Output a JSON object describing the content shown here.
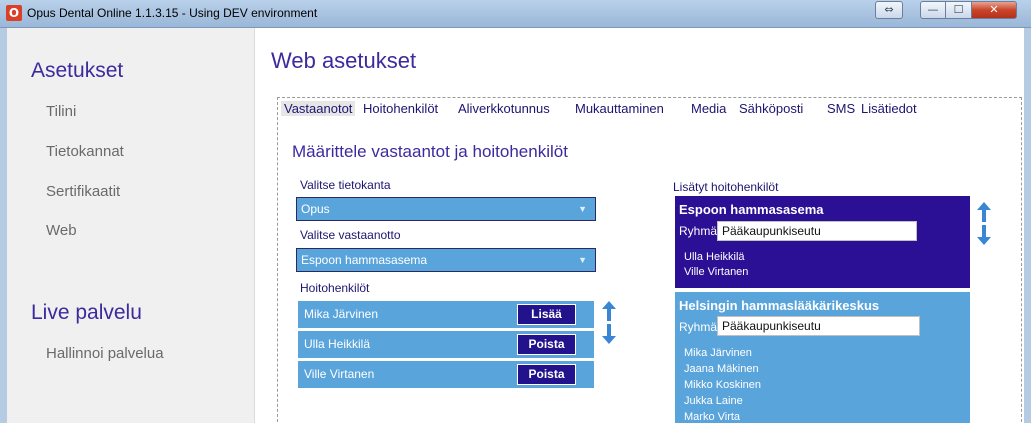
{
  "window": {
    "title": "Opus Dental Online 1.1.3.15 - Using DEV environment",
    "close_glyph": "✕",
    "minimize_glyph": "—",
    "maximize_glyph": "☐",
    "resize_glyph": "⇔"
  },
  "sidebar": {
    "header_settings": "Asetukset",
    "items": [
      {
        "label": "Tilini"
      },
      {
        "label": "Tietokannat"
      },
      {
        "label": "Sertifikaatit"
      },
      {
        "label": "Web"
      }
    ],
    "header_live": "Live palvelu",
    "live_items": [
      {
        "label": "Hallinnoi palvelua"
      }
    ]
  },
  "main": {
    "title": "Web asetukset",
    "tabs": [
      {
        "label": "Vastaanotot",
        "active": true
      },
      {
        "label": "Hoitohenkilöt"
      },
      {
        "label": "Aliverkkotunnus"
      },
      {
        "label": "Mukauttaminen"
      },
      {
        "label": "Media"
      },
      {
        "label": "Sähköposti"
      },
      {
        "label": "SMS"
      },
      {
        "label": "Lisätiedot"
      }
    ],
    "section_title": "Määrittele vastaantot ja hoitohenkilöt",
    "database_label": "Valitse tietokanta",
    "database_value": "Opus",
    "clinic_label": "Valitse vastaanotto",
    "clinic_value": "Espoon hammasasema",
    "staff_label": "Hoitohenkilöt",
    "staff": [
      {
        "name": "Mika Järvinen",
        "action": "Lisää"
      },
      {
        "name": "Ulla Heikkilä",
        "action": "Poista"
      },
      {
        "name": "Ville Virtanen",
        "action": "Poista"
      }
    ],
    "added_label": "Lisätyt hoitohenkilöt",
    "groups": [
      {
        "name": "Espoon hammasasema",
        "group_label": "Ryhmä",
        "group_value": "Pääkaupunkiseutu",
        "members": [
          "Ulla Heikkilä",
          "Ville Virtanen"
        ],
        "color": "#2b0f94"
      },
      {
        "name": "Helsingin hammaslääkärikeskus",
        "group_label": "Ryhmä",
        "group_value": "Pääkaupunkiseutu",
        "members": [
          "Mika Järvinen",
          "Jaana Mäkinen",
          "Mikko Koskinen",
          "Jukka Laine",
          "Marko Virta"
        ],
        "color": "#5aa4dc"
      }
    ]
  },
  "colors": {
    "accent": "#3c2a9e",
    "field_blue": "#5aa4dc",
    "button_dark": "#22128c",
    "arrow_blue": "#3a86d4"
  }
}
